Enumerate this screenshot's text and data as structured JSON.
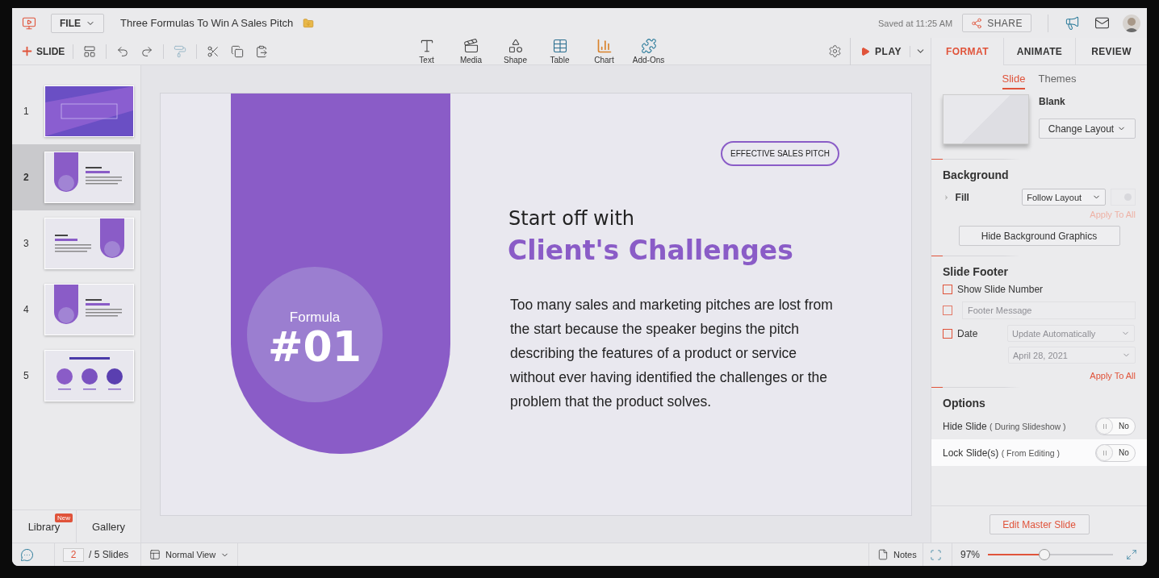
{
  "top_bar": {
    "file_menu": "FILE",
    "document_title": "Three Formulas To Win A Sales Pitch",
    "save_status": "Saved at 11:25 AM",
    "share_button": "SHARE"
  },
  "toolbar": {
    "new_slide_button": "SLIDE",
    "insert_tools": [
      {
        "kind": "text",
        "label": "Text"
      },
      {
        "kind": "media",
        "label": "Media"
      },
      {
        "kind": "shape",
        "label": "Shape"
      },
      {
        "kind": "table",
        "label": "Table"
      },
      {
        "kind": "chart",
        "label": "Chart"
      },
      {
        "kind": "addons",
        "label": "Add-Ons"
      }
    ],
    "play_button": "PLAY"
  },
  "panel_tabs": [
    {
      "label": "FORMAT",
      "selected": true
    },
    {
      "label": "ANIMATE",
      "selected": false
    },
    {
      "label": "REVIEW",
      "selected": false
    }
  ],
  "slides_panel": {
    "slides": [
      {
        "number": "1",
        "kind": "title",
        "selected": false
      },
      {
        "number": "2",
        "kind": "formula-left",
        "selected": true
      },
      {
        "number": "3",
        "kind": "formula-right",
        "selected": false
      },
      {
        "number": "4",
        "kind": "formula-left",
        "selected": false
      },
      {
        "number": "5",
        "kind": "summary",
        "selected": false
      }
    ],
    "bottom_tabs": [
      {
        "label": "Library",
        "badge": "New"
      },
      {
        "label": "Gallery"
      }
    ]
  },
  "slide": {
    "badge": "EFFECTIVE SALES PITCH",
    "formula_label": "Formula",
    "formula_number": "#01",
    "heading_intro": "Start off with",
    "heading": "Client's Challenges",
    "body": "Too many sales and marketing pitches are lost from the start because the speaker begins the pitch describing the features of a product or service without ever having identified the challenges or the problem that the product solves."
  },
  "format_panel": {
    "subtabs": [
      {
        "label": "Slide",
        "selected": true
      },
      {
        "label": "Themes",
        "selected": false
      }
    ],
    "layout_name": "Blank",
    "change_layout_button": "Change Layout",
    "background": {
      "title": "Background",
      "fill_label": "Fill",
      "fill_select": "Follow Layout",
      "apply_to_all": {
        "label": "Apply To All",
        "disabled": true
      },
      "hide_graphics_button": "Hide Background Graphics"
    },
    "footer": {
      "title": "Slide Footer",
      "show_slide_number": {
        "label": "Show Slide Number",
        "checked": false
      },
      "footer_message": {
        "placeholder": "Footer Message",
        "checked": false,
        "disabled": true
      },
      "date": {
        "label": "Date",
        "checked": false,
        "mode_select": "Update Automatically",
        "date_select": "April 28, 2021",
        "disabled": true
      },
      "apply_to_all": {
        "label": "Apply To All",
        "disabled": false
      }
    },
    "options": {
      "title": "Options",
      "rows": [
        {
          "label": "Hide Slide",
          "note": "( During Slideshow )",
          "on": false,
          "value": "No",
          "highlighted": false
        },
        {
          "label": "Lock Slide(s)",
          "note": "( From Editing )",
          "on": false,
          "value": "No",
          "highlighted": true
        }
      ]
    },
    "edit_master_button": "Edit Master Slide"
  },
  "status_bar": {
    "current_slide": "2",
    "slide_count": "/ 5 Slides",
    "view_menu": "Normal View",
    "notes_button": "Notes",
    "zoom": {
      "reading": "97%",
      "level": 0.45
    }
  }
}
